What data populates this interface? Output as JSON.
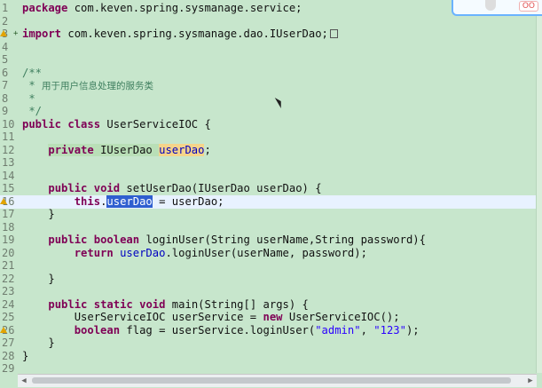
{
  "editor": {
    "lines": [
      {
        "num": "1",
        "segments": [
          {
            "t": "package",
            "c": "kw"
          },
          {
            "t": " com.keven.spring.sysmanage.service;",
            "c": ""
          }
        ]
      },
      {
        "num": "2",
        "segments": []
      },
      {
        "num": "3",
        "segments": [
          {
            "t": "import",
            "c": "kw"
          },
          {
            "t": " com.keven.spring.sysmanage.dao.IUserDao;",
            "c": ""
          }
        ]
      },
      {
        "num": "4",
        "segments": []
      },
      {
        "num": "5",
        "segments": []
      },
      {
        "num": "6",
        "segments": [
          {
            "t": "/**",
            "c": "cm"
          }
        ]
      },
      {
        "num": "7",
        "segments": [
          {
            "t": " * ",
            "c": "cm"
          },
          {
            "t": "用于用户信息处理的服务类",
            "c": "cm cmzh"
          }
        ]
      },
      {
        "num": "8",
        "segments": [
          {
            "t": " *",
            "c": "cm"
          }
        ]
      },
      {
        "num": "9",
        "segments": [
          {
            "t": " */",
            "c": "cm"
          }
        ]
      },
      {
        "num": "10",
        "segments": [
          {
            "t": "public",
            "c": "kw"
          },
          {
            "t": " ",
            "c": ""
          },
          {
            "t": "class",
            "c": "kw"
          },
          {
            "t": " UserServiceIOC {",
            "c": ""
          }
        ]
      },
      {
        "num": "11",
        "segments": []
      },
      {
        "num": "12",
        "segments": [
          {
            "t": "    ",
            "c": ""
          },
          {
            "t": "private",
            "c": "kw hl"
          },
          {
            "t": " IUserDao ",
            "c": "hl"
          },
          {
            "t": "userDao",
            "c": "fld hl2"
          },
          {
            "t": ";",
            "c": ""
          }
        ]
      },
      {
        "num": "13",
        "segments": []
      },
      {
        "num": "14",
        "segments": []
      },
      {
        "num": "15",
        "segments": [
          {
            "t": "    ",
            "c": ""
          },
          {
            "t": "public",
            "c": "kw"
          },
          {
            "t": " ",
            "c": ""
          },
          {
            "t": "void",
            "c": "kw"
          },
          {
            "t": " setUserDao(IUserDao userDao) {",
            "c": ""
          }
        ]
      },
      {
        "num": "16",
        "segments": [
          {
            "t": "        ",
            "c": ""
          },
          {
            "t": "this",
            "c": "kw"
          },
          {
            "t": ".",
            "c": ""
          },
          {
            "t": "userDao",
            "c": "sel"
          },
          {
            "t": " = userDao;",
            "c": ""
          }
        ]
      },
      {
        "num": "17",
        "segments": [
          {
            "t": "    }",
            "c": ""
          }
        ]
      },
      {
        "num": "18",
        "segments": []
      },
      {
        "num": "19",
        "segments": [
          {
            "t": "    ",
            "c": ""
          },
          {
            "t": "public",
            "c": "kw"
          },
          {
            "t": " ",
            "c": ""
          },
          {
            "t": "boolean",
            "c": "kw"
          },
          {
            "t": " loginUser(String userName,String password){",
            "c": ""
          }
        ]
      },
      {
        "num": "20",
        "segments": [
          {
            "t": "        ",
            "c": ""
          },
          {
            "t": "return",
            "c": "kw"
          },
          {
            "t": " ",
            "c": ""
          },
          {
            "t": "userDao",
            "c": "fld"
          },
          {
            "t": ".loginUser(userName, password);",
            "c": ""
          }
        ]
      },
      {
        "num": "21",
        "segments": []
      },
      {
        "num": "22",
        "segments": [
          {
            "t": "    }",
            "c": ""
          }
        ]
      },
      {
        "num": "23",
        "segments": []
      },
      {
        "num": "24",
        "segments": [
          {
            "t": "    ",
            "c": ""
          },
          {
            "t": "public",
            "c": "kw"
          },
          {
            "t": " ",
            "c": ""
          },
          {
            "t": "static",
            "c": "kw"
          },
          {
            "t": " ",
            "c": ""
          },
          {
            "t": "void",
            "c": "kw"
          },
          {
            "t": " main(String[] args) {",
            "c": ""
          }
        ]
      },
      {
        "num": "25",
        "segments": [
          {
            "t": "        UserServiceIOC userService = ",
            "c": ""
          },
          {
            "t": "new",
            "c": "kw"
          },
          {
            "t": " UserServiceIOC();",
            "c": ""
          }
        ]
      },
      {
        "num": "26",
        "segments": [
          {
            "t": "        ",
            "c": ""
          },
          {
            "t": "boolean",
            "c": "kw"
          },
          {
            "t": " flag = userService.loginUser(",
            "c": ""
          },
          {
            "t": "\"admin\"",
            "c": "str"
          },
          {
            "t": ", ",
            "c": ""
          },
          {
            "t": "\"123\"",
            "c": "str"
          },
          {
            "t": ");",
            "c": ""
          }
        ]
      },
      {
        "num": "27",
        "segments": [
          {
            "t": "    }",
            "c": ""
          }
        ]
      },
      {
        "num": "28",
        "segments": [
          {
            "t": "}",
            "c": ""
          }
        ]
      },
      {
        "num": "29",
        "segments": []
      }
    ]
  },
  "overlay": {
    "badge": "OO"
  },
  "colors": {
    "background": "#c7e6cc",
    "keyword": "#7f0055",
    "comment": "#3f7f5f",
    "field": "#0000c0",
    "string": "#2a00ff",
    "selection": "#2f5fd0"
  }
}
